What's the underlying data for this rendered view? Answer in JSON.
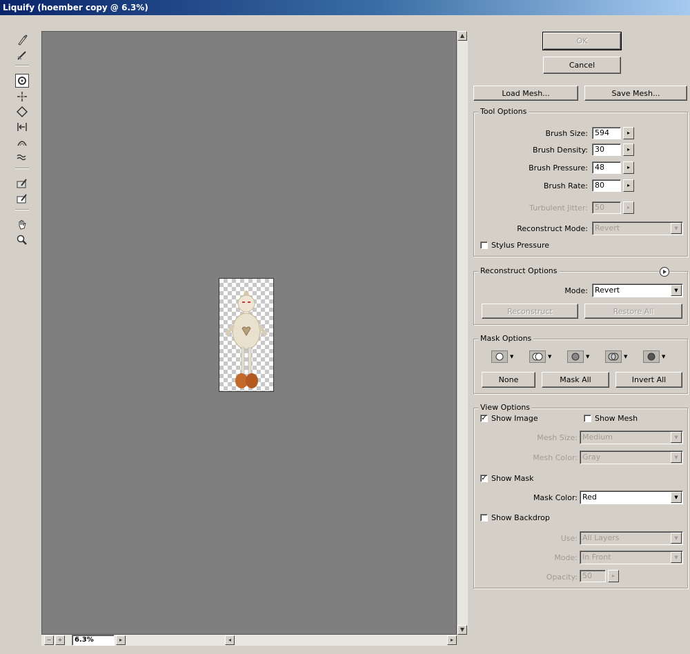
{
  "window": {
    "title": "Liquify (hoember copy @ 6.3%)"
  },
  "tools": [
    {
      "name": "forward-warp-tool"
    },
    {
      "name": "reconstruct-tool"
    },
    {
      "name": "twirl-clockwise-tool",
      "active": true
    },
    {
      "name": "pucker-tool"
    },
    {
      "name": "bloat-tool"
    },
    {
      "name": "push-left-tool"
    },
    {
      "name": "mirror-tool"
    },
    {
      "name": "turbulence-tool"
    },
    {
      "name": "freeze-mask-tool"
    },
    {
      "name": "thaw-mask-tool"
    },
    {
      "name": "hand-tool"
    },
    {
      "name": "zoom-tool"
    }
  ],
  "buttons": {
    "ok": "OK",
    "cancel": "Cancel",
    "load_mesh": "Load Mesh...",
    "save_mesh": "Save Mesh..."
  },
  "tool_options": {
    "title": "Tool Options",
    "brush_size_label": "Brush Size:",
    "brush_size": "594",
    "brush_density_label": "Brush Density:",
    "brush_density": "30",
    "brush_pressure_label": "Brush Pressure:",
    "brush_pressure": "48",
    "brush_rate_label": "Brush Rate:",
    "brush_rate": "80",
    "turbulent_jitter_label": "Turbulent Jitter:",
    "turbulent_jitter": "50",
    "reconstruct_mode_label": "Reconstruct Mode:",
    "reconstruct_mode": "Revert",
    "stylus_pressure": "Stylus Pressure"
  },
  "reconstruct_options": {
    "title": "Reconstruct Options",
    "mode_label": "Mode:",
    "mode": "Revert",
    "reconstruct": "Reconstruct",
    "restore_all": "Restore All"
  },
  "mask_options": {
    "title": "Mask Options",
    "none": "None",
    "mask_all": "Mask All",
    "invert_all": "Invert All"
  },
  "view_options": {
    "title": "View Options",
    "show_image": "Show Image",
    "show_mesh": "Show Mesh",
    "mesh_size_label": "Mesh Size:",
    "mesh_size": "Medium",
    "mesh_color_label": "Mesh Color:",
    "mesh_color": "Gray",
    "show_mask": "Show Mask",
    "mask_color_label": "Mask Color:",
    "mask_color": "Red",
    "show_backdrop": "Show Backdrop",
    "use_label": "Use:",
    "use": "All Layers",
    "mode_label": "Mode:",
    "mode": "In Front",
    "opacity_label": "Opacity:",
    "opacity": "50"
  },
  "zoom": {
    "value": "6.3%",
    "minus": "−",
    "plus": "+"
  },
  "checkmark": "✓"
}
